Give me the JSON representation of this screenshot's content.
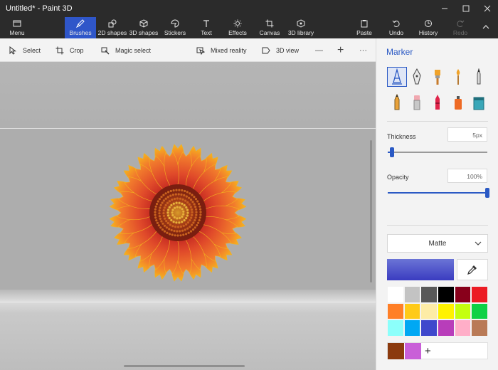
{
  "window": {
    "title": "Untitled* - Paint 3D"
  },
  "ribbon": {
    "menu": "Menu",
    "tabs": [
      "Brushes",
      "2D shapes",
      "3D shapes",
      "Stickers",
      "Text",
      "Effects",
      "Canvas",
      "3D library"
    ],
    "active_tab": "Brushes",
    "actions": [
      "Paste",
      "Undo",
      "History",
      "Redo"
    ]
  },
  "toolbar": {
    "select": "Select",
    "crop": "Crop",
    "magic_select": "Magic select",
    "mixed_reality": "Mixed reality",
    "view_3d": "3D view",
    "zoom_out": "—",
    "zoom_in": "+",
    "more": "···"
  },
  "panel": {
    "title": "Marker",
    "brushes": [
      "marker",
      "calligraphy-pen",
      "oil-brush",
      "watercolor",
      "pixel-pen",
      "pencil",
      "eraser",
      "crayon",
      "spray-can",
      "fill"
    ],
    "active_brush": "marker",
    "thickness_label": "Thickness",
    "thickness_value": "5px",
    "thickness_level": 0.04,
    "opacity_label": "Opacity",
    "opacity_value": "100%",
    "opacity_level": 1.0,
    "finish": "Matte",
    "current_color": "#3a3cc0",
    "palette": [
      "#ffffff",
      "#c3c3c3",
      "#585858",
      "#000000",
      "#88001b",
      "#ec1c24",
      "#ff7f27",
      "#ffca18",
      "#fdeca6",
      "#fff200",
      "#c4ff0e",
      "#0ed145",
      "#8cfffb",
      "#00a8f3",
      "#3f48cc",
      "#b83dba",
      "#ffaec8",
      "#b97a56"
    ],
    "custom_colors": [
      "#8b3a0e",
      "#c95fd8"
    ],
    "add_color": "+"
  }
}
